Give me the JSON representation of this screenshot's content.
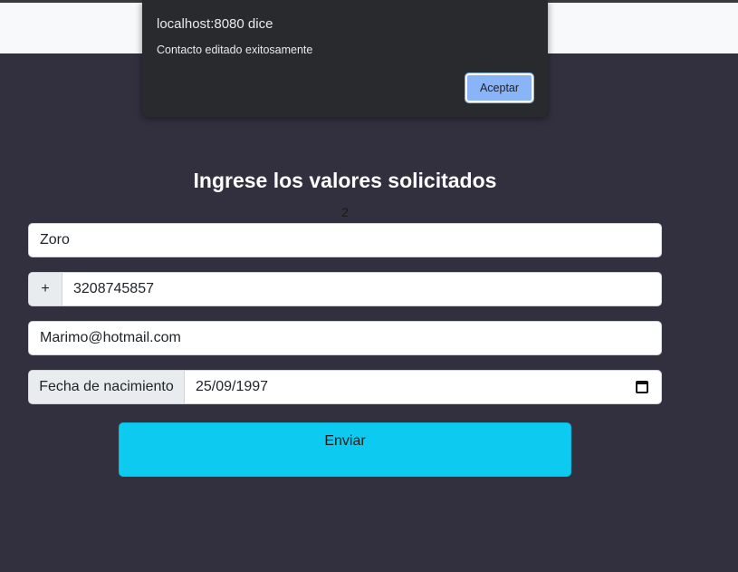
{
  "dialog": {
    "title": "localhost:8080 dice",
    "message": "Contacto editado exitosamente",
    "ok_label": "Aceptar"
  },
  "form": {
    "heading": "Ingrese los valores solicitados",
    "record_id": "2",
    "name_value": "Zoro",
    "phone_prefix": "+",
    "phone_value": "3208745857",
    "email_value": "Marimo@hotmail.com",
    "birthdate_label": "Fecha de nacimiento",
    "birthdate_value": "25/09/1997",
    "submit_label": "Enviar"
  },
  "colors": {
    "background": "#32303f",
    "submit": "#0dcaf0",
    "dialog": "#292a2d",
    "dialog_button": "#8ab4f8"
  }
}
